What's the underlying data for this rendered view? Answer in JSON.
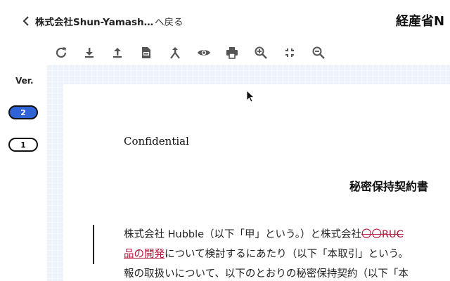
{
  "header": {
    "breadcrumb": "株式会社Shun-Yamash…",
    "back_label": "へ戻る",
    "doc_title": "経産省N"
  },
  "versions": {
    "label": "Ver.",
    "items": [
      {
        "label": "2",
        "active": true
      },
      {
        "label": "1",
        "active": false
      }
    ]
  },
  "toolbar": {
    "icons": [
      "refresh-icon",
      "download-icon",
      "upload-icon",
      "export-pdf-icon",
      "merge-icon",
      "preview-eye-icon",
      "print-icon",
      "zoom-in-icon",
      "fit-shrink-icon",
      "zoom-out-icon"
    ]
  },
  "document": {
    "confidential": "Confidential",
    "title": "秘密保持契約書",
    "line1_a": "株式会社 Hubble（以下「甲」という。）と株式会社",
    "line1_del": "〇〇RUC",
    "line2_ins": "品の開発",
    "line2_b": "について検討するにあたり（以下「本取引」という。",
    "line3": "報の取扱いについて、以下のとおりの秘密保持契約（以下「本"
  },
  "colors": {
    "accent": "#2f63d6",
    "change": "#b3143b",
    "viewer_bg": "#edf3f9"
  }
}
